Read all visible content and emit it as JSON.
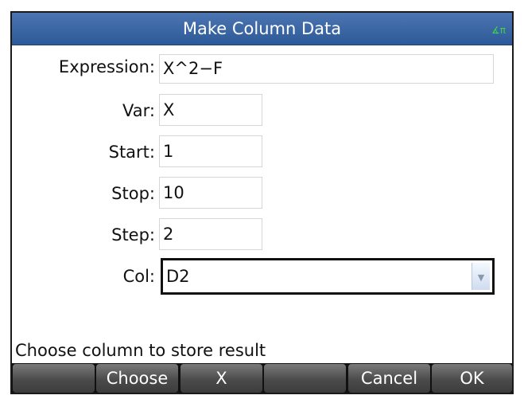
{
  "window": {
    "title": "Make Column Data",
    "angle_mode_icon": "angle-radians-icon",
    "angle_mode_text": "∡π"
  },
  "form": {
    "expression": {
      "label": "Expression:",
      "value": "X^2−F"
    },
    "var": {
      "label": "Var:",
      "value": "X"
    },
    "start": {
      "label": "Start:",
      "value": "1"
    },
    "stop": {
      "label": "Stop:",
      "value": "10"
    },
    "step": {
      "label": "Step:",
      "value": "2"
    },
    "col": {
      "label": "Col:",
      "value": "D2",
      "dropdown_icon": "▼"
    }
  },
  "status_text": "Choose column to store result",
  "softkeys": [
    "",
    "Choose",
    "X",
    "",
    "Cancel",
    "OK"
  ],
  "colors": {
    "titlebar": "#2d5998",
    "softkey_bar": "#111111",
    "angle_indicator": "#3fd34a"
  }
}
